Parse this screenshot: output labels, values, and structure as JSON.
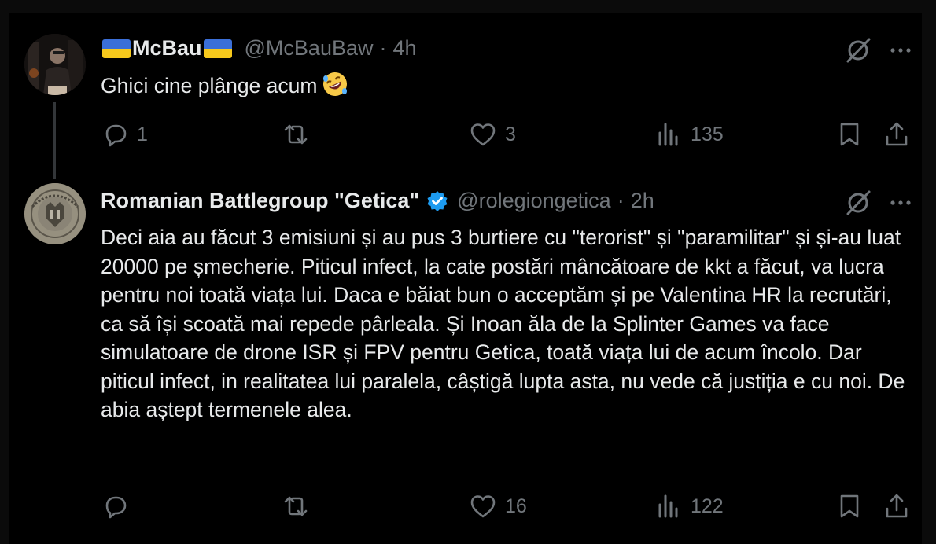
{
  "colors": {
    "background": "#000000",
    "text_primary": "#e7e9ea",
    "text_secondary": "#71767b",
    "verified": "#1d9bf0",
    "thread_line": "#333639"
  },
  "tweets": [
    {
      "avatar_icon": "profile-photo",
      "name_flag_left": "flag-ukraine-icon",
      "name": "McBau",
      "name_flag_right": "flag-ukraine-icon",
      "handle": "@McBauBaw",
      "separator": "·",
      "time": "4h",
      "text": "Ghici cine plânge acum",
      "emoji": "rolling-on-floor-laughing-emoji",
      "actions": {
        "replies": "1",
        "retweets": "",
        "likes": "3",
        "views": "135"
      }
    },
    {
      "avatar_icon": "battlegroup-emblem",
      "name": "Romanian Battlegroup \"Getica\"",
      "verified_icon": "verified-badge-icon",
      "handle": "@rolegiongetica",
      "separator": "·",
      "time": "2h",
      "text": "Deci aia au făcut 3 emisiuni și au pus  3 burtiere cu \"terorist\" și \"paramilitar\" și și-au luat 20000 pe șmecherie. Piticul infect, la cate postări mâncătoare de kkt a făcut, va lucra pentru noi toată viața lui. Daca e băiat bun o acceptăm și pe Valentina HR la recrutări, ca să își scoată mai repede pârleala.  Și Inoan ăla de la Splinter Games va face simulatoare de drone ISR și FPV pentru Getica, toată viața lui de acum încolo. Dar piticul infect, in realitatea lui paralela, câștigă lupta asta, nu vede că justiția e cu noi. De abia aștept termenele alea.",
      "actions": {
        "replies": "",
        "retweets": "",
        "likes": "16",
        "views": "122"
      }
    }
  ],
  "icons": {
    "reply": "reply-icon",
    "retweet": "retweet-icon",
    "like": "heart-icon",
    "views": "views-icon",
    "bookmark": "bookmark-icon",
    "share": "share-icon",
    "grok": "grok-icon",
    "more": "more-icon"
  }
}
